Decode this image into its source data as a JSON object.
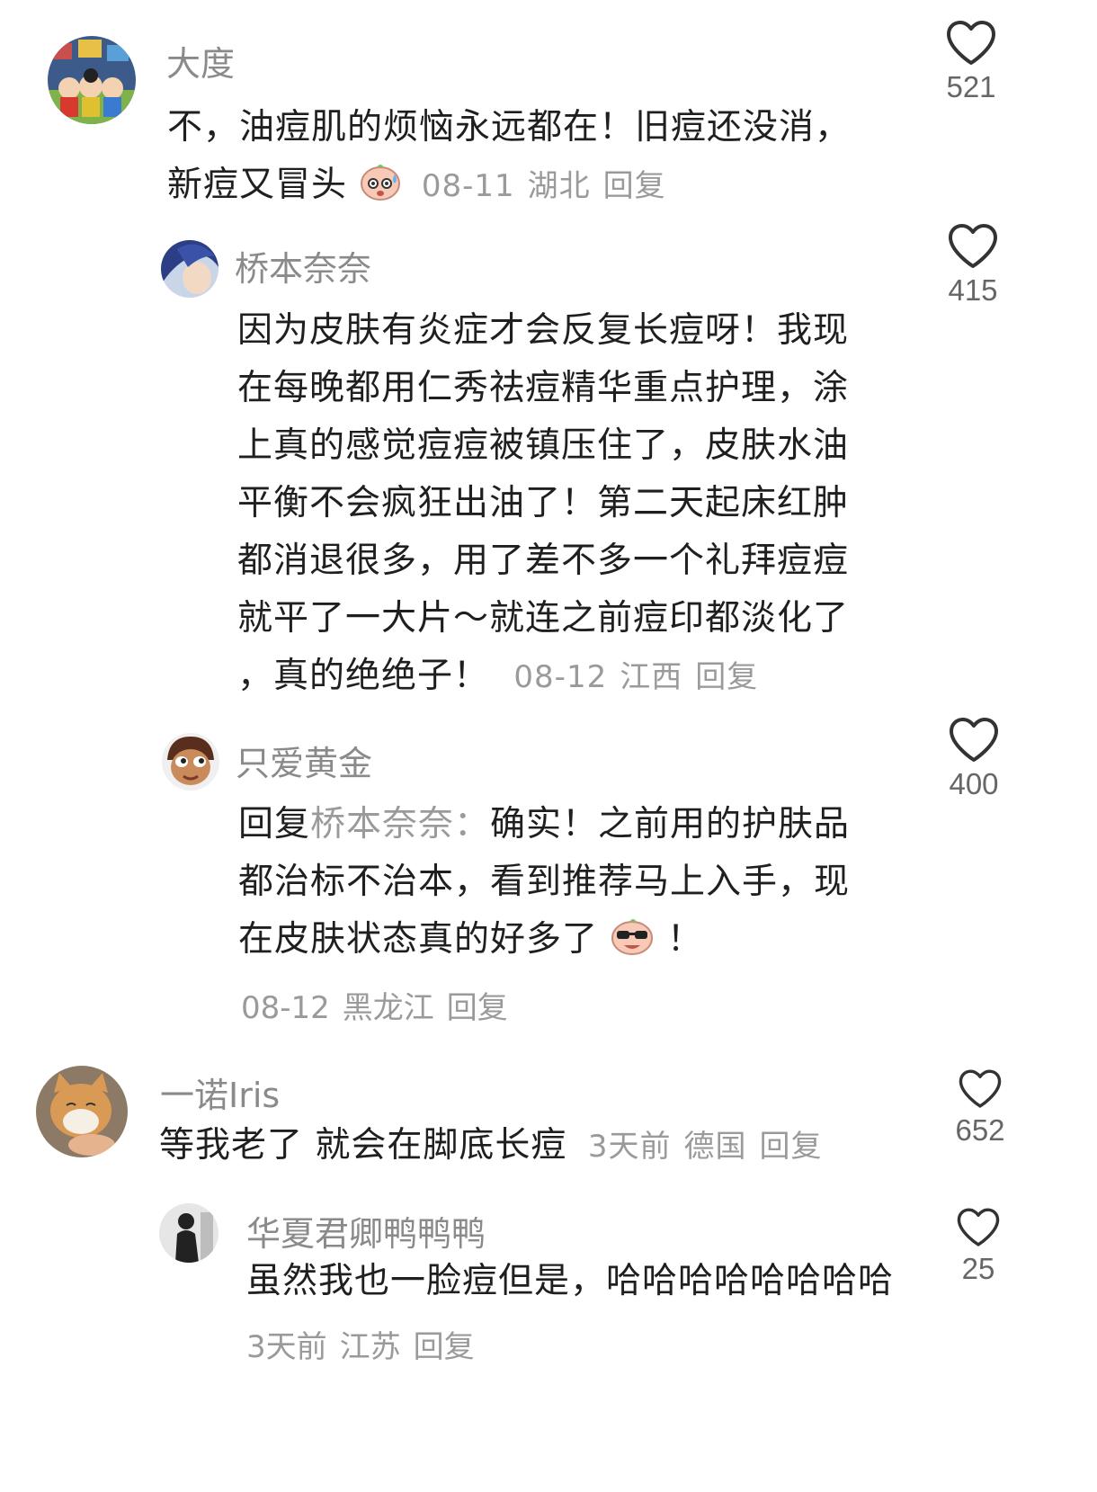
{
  "comments": [
    {
      "username": "大度",
      "text_line1": "不，油痘肌的烦恼永远都在！旧痘还没消，",
      "text_line2": "新痘又冒头",
      "date": "08-11",
      "location": "湖北",
      "reply_label": "回复",
      "likes": "521",
      "avatar_icon": "cartoon-group-avatar"
    },
    {
      "username": "桥本奈奈",
      "lines": [
        "因为皮肤有炎症才会反复长痘呀！我现",
        "在每晚都用仁秀祛痘精华重点护理，涂",
        "上真的感觉痘痘被镇压住了，皮肤水油",
        "平衡不会疯狂出油了！第二天起床红肿",
        "都消退很多，用了差不多一个礼拜痘痘",
        "就平了一大片～就连之前痘印都淡化了"
      ],
      "last_line": "，真的绝绝子！",
      "date": "08-12",
      "location": "江西",
      "reply_label": "回复",
      "likes": "415",
      "avatar_icon": "anime-blue-hair-avatar"
    },
    {
      "username": "只爱黄金",
      "reply_prefix": "回复",
      "reply_target": "桥本奈奈：",
      "line1": "确实！之前用的护肤品",
      "line2": "都治标不治本，看到推荐马上入手，现",
      "line3": "在皮肤状态真的好多了",
      "line3_end": "！",
      "date": "08-12",
      "location": "黑龙江",
      "reply_label": "回复",
      "likes": "400",
      "avatar_icon": "cartoon-girl-avatar"
    },
    {
      "username": "一诺Iris",
      "text": "等我老了 就会在脚底长痘",
      "date": "3天前",
      "location": "德国",
      "reply_label": "回复",
      "likes": "652",
      "avatar_icon": "cat-photo-avatar"
    },
    {
      "username": "华夏君卿鸭鸭鸭",
      "text": "虽然我也一脸痘但是，哈哈哈哈哈哈哈哈",
      "date": "3天前",
      "location": "江苏",
      "reply_label": "回复",
      "likes": "25",
      "avatar_icon": "silhouette-avatar"
    }
  ],
  "emojis": [
    "sweat-face-emoji",
    "cool-sunglasses-emoji"
  ],
  "colors": {
    "username": "#8a8a8a",
    "text": "#1f1f1f",
    "meta": "#9a9a9a",
    "like_count": "#666666",
    "heart_stroke": "#333333"
  }
}
